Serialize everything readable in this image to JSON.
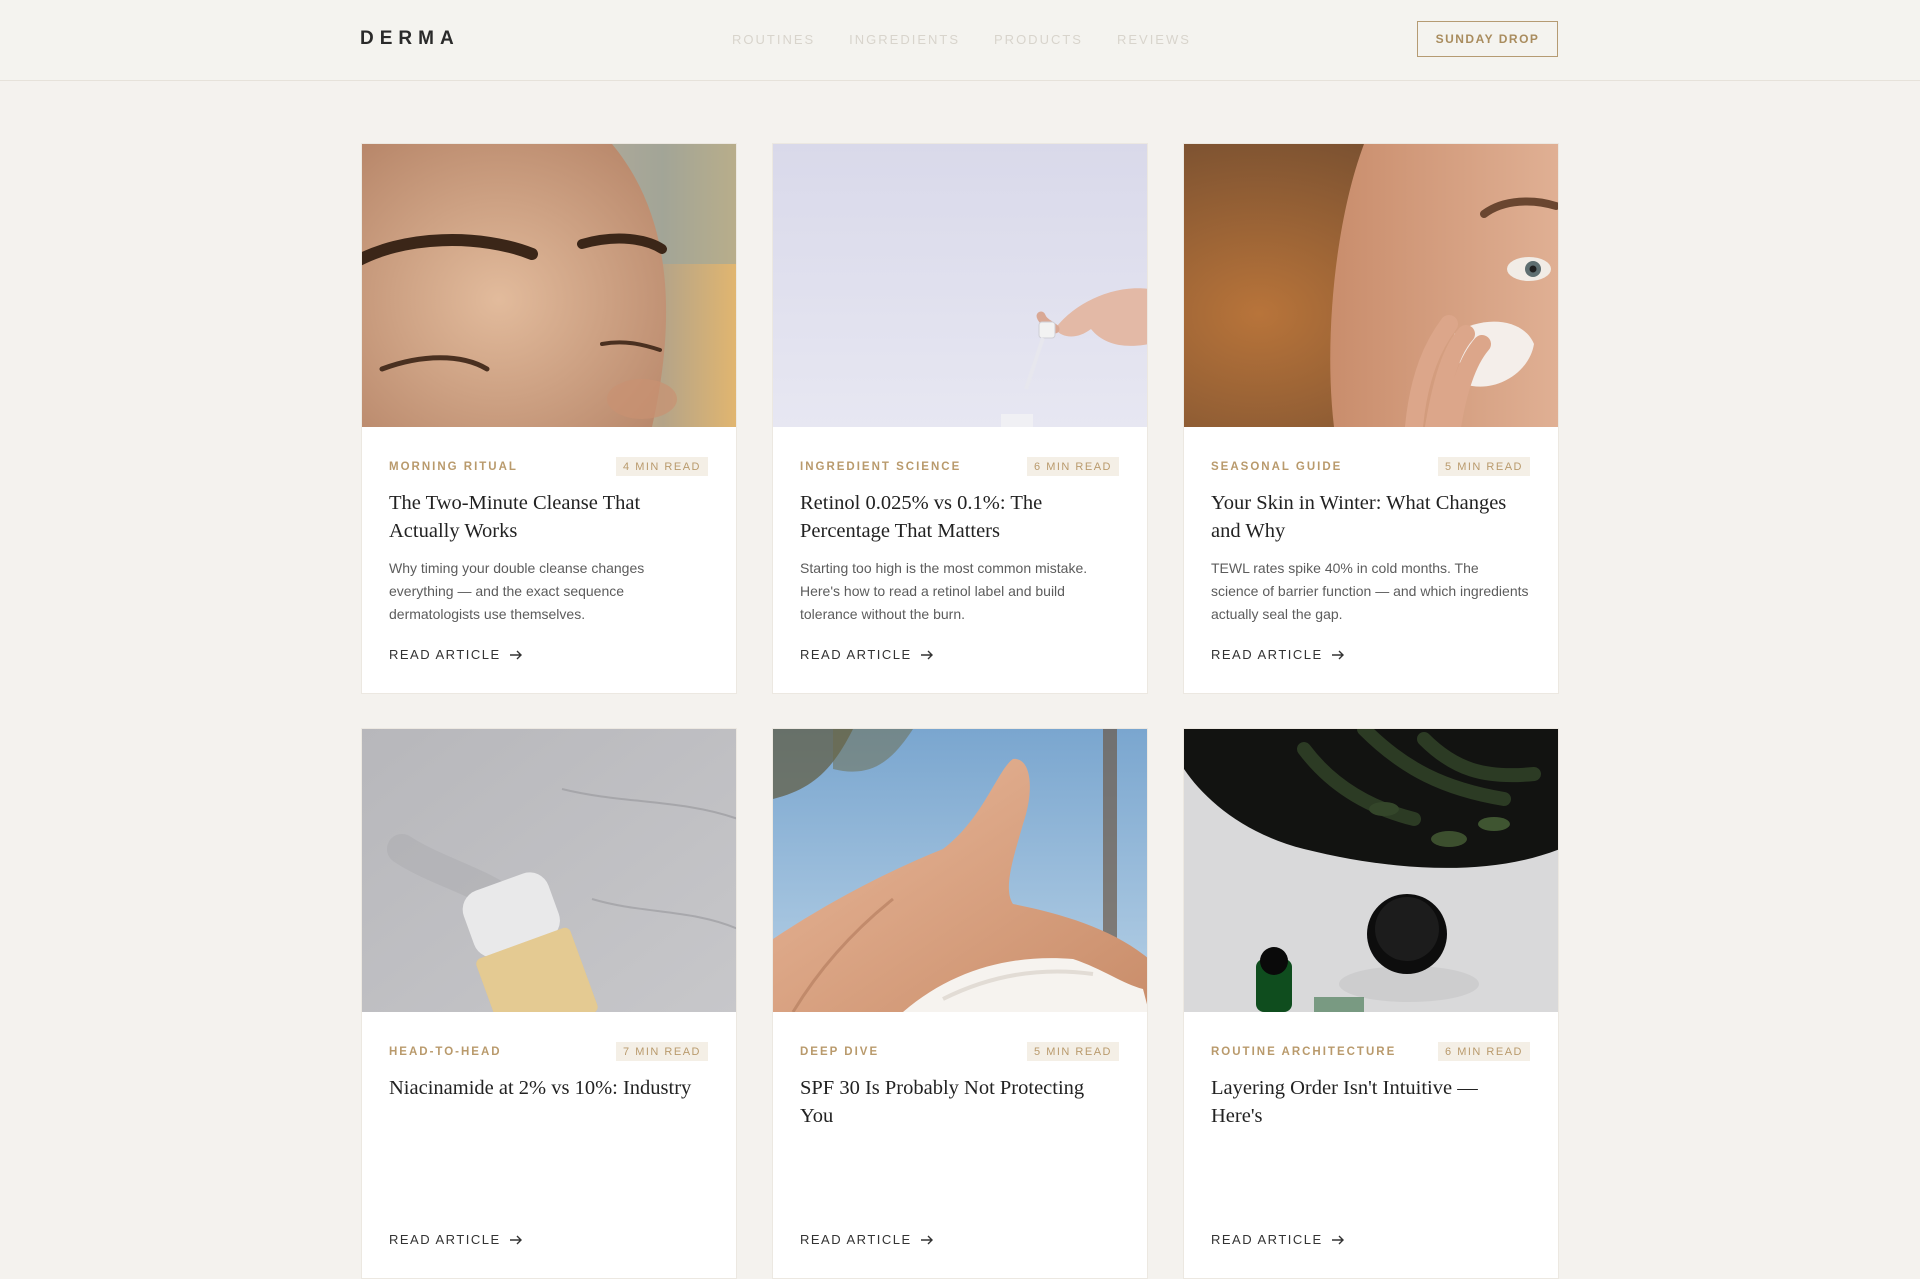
{
  "header": {
    "logo": "DERMA",
    "nav": [
      "ROUTINES",
      "INGREDIENTS",
      "PRODUCTS",
      "REVIEWS"
    ],
    "cta_label": "SUNDAY DROP"
  },
  "cards": [
    {
      "category": "MORNING RITUAL",
      "read_time": "4 MIN READ",
      "title": "The Two-Minute Cleanse That Actually Works",
      "excerpt": "Why timing your double cleanse changes everything — and the exact sequence dermatologists use themselves.",
      "link": "READ ARTICLE"
    },
    {
      "category": "INGREDIENT SCIENCE",
      "read_time": "6 MIN READ",
      "title": "Retinol 0.025% vs 0.1%: The Percentage That Matters",
      "excerpt": "Starting too high is the most common mistake. Here's how to read a retinol label and build tolerance without the burn.",
      "link": "READ ARTICLE"
    },
    {
      "category": "SEASONAL GUIDE",
      "read_time": "5 MIN READ",
      "title": "Your Skin in Winter: What Changes and Why",
      "excerpt": "TEWL rates spike 40% in cold months. The science of barrier function — and which ingredients actually seal the gap.",
      "link": "READ ARTICLE"
    },
    {
      "category": "HEAD-TO-HEAD",
      "read_time": "7 MIN READ",
      "title": "Niacinamide at 2% vs 10%: Industry",
      "excerpt": "",
      "link": "READ ARTICLE"
    },
    {
      "category": "DEEP DIVE",
      "read_time": "5 MIN READ",
      "title": "SPF 30 Is Probably Not Protecting You",
      "excerpt": "",
      "link": "READ ARTICLE"
    },
    {
      "category": "ROUTINE ARCHITECTURE",
      "read_time": "6 MIN READ",
      "title": "Layering Order Isn't Intuitive — Here's",
      "excerpt": "",
      "link": "READ ARTICLE"
    }
  ],
  "colors": {
    "background": "#f4f2ee",
    "accent": "#b99a6c",
    "card": "#ffffff"
  },
  "icons": [
    "arrow-right-icon"
  ]
}
